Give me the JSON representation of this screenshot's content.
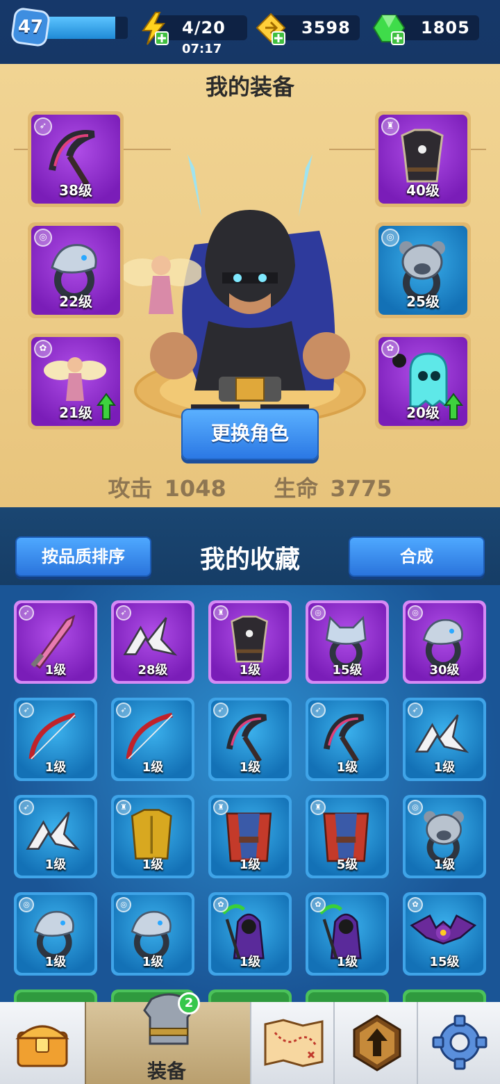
{
  "top_bar": {
    "player_level": "47",
    "xp_progress": 0.85,
    "energy": "4/20",
    "energy_timer": "07:17",
    "gold": "3598",
    "gems": "1805"
  },
  "equipment": {
    "title": "我的装备",
    "slots": [
      {
        "level": "38级",
        "type_icon": "weapon-icon",
        "art": "scythe",
        "color": "purple"
      },
      {
        "level": "22级",
        "type_icon": "ring-icon",
        "art": "dragon-ring",
        "color": "purple"
      },
      {
        "level": "21级",
        "type_icon": "pet-icon",
        "art": "fairy",
        "color": "purple",
        "upgrade": true
      },
      {
        "level": "40级",
        "type_icon": "armor-icon",
        "art": "dark-armor",
        "color": "purple"
      },
      {
        "level": "25级",
        "type_icon": "ring-icon",
        "art": "bear-ring",
        "color": "blue"
      },
      {
        "level": "20级",
        "type_icon": "pet-icon",
        "art": "ghost",
        "color": "purple",
        "upgrade": true
      }
    ],
    "change_button": "更换角色",
    "attack_label": "攻击",
    "attack_value": "1048",
    "hp_label": "生命",
    "hp_value": "3775"
  },
  "collection": {
    "sort_button": "按品质排序",
    "title": "我的收藏",
    "merge_button": "合成",
    "items": [
      {
        "level": "1级",
        "color": "purple",
        "type_icon": "weapon-icon",
        "art": "sword"
      },
      {
        "level": "28级",
        "color": "purple",
        "type_icon": "weapon-icon",
        "art": "shuriken"
      },
      {
        "level": "1级",
        "color": "purple",
        "type_icon": "armor-icon",
        "art": "dark-armor"
      },
      {
        "level": "15级",
        "color": "purple",
        "type_icon": "ring-icon",
        "art": "wolf-ring"
      },
      {
        "level": "30级",
        "color": "purple",
        "type_icon": "ring-icon",
        "art": "dragon-ring"
      },
      {
        "level": "1级",
        "color": "blue",
        "type_icon": "weapon-icon",
        "art": "bow"
      },
      {
        "level": "1级",
        "color": "blue",
        "type_icon": "weapon-icon",
        "art": "bow"
      },
      {
        "level": "1级",
        "color": "blue",
        "type_icon": "weapon-icon",
        "art": "scythe"
      },
      {
        "level": "1级",
        "color": "blue",
        "type_icon": "weapon-icon",
        "art": "scythe"
      },
      {
        "level": "1级",
        "color": "blue",
        "type_icon": "weapon-icon",
        "art": "shuriken"
      },
      {
        "level": "1级",
        "color": "blue",
        "type_icon": "weapon-icon",
        "art": "shuriken"
      },
      {
        "level": "1级",
        "color": "blue",
        "type_icon": "armor-icon",
        "art": "gold-armor"
      },
      {
        "level": "1级",
        "color": "blue",
        "type_icon": "armor-icon",
        "art": "red-robe"
      },
      {
        "level": "5级",
        "color": "blue",
        "type_icon": "armor-icon",
        "art": "red-robe"
      },
      {
        "level": "1级",
        "color": "blue",
        "type_icon": "ring-icon",
        "art": "bear-ring"
      },
      {
        "level": "1级",
        "color": "blue",
        "type_icon": "ring-icon",
        "art": "dragon-ring"
      },
      {
        "level": "1级",
        "color": "blue",
        "type_icon": "ring-icon",
        "art": "dragon-ring"
      },
      {
        "level": "1级",
        "color": "blue",
        "type_icon": "pet-icon",
        "art": "reaper"
      },
      {
        "level": "1级",
        "color": "blue",
        "type_icon": "pet-icon",
        "art": "reaper"
      },
      {
        "level": "15级",
        "color": "blue",
        "type_icon": "pet-icon",
        "art": "bat"
      }
    ]
  },
  "bottom_nav": {
    "active_label": "装备",
    "badge": "2",
    "tabs": [
      "chest-icon",
      "armor-icon",
      "map-icon",
      "upgrade-icon",
      "gear-icon"
    ]
  },
  "colors": {
    "purple": "#8a2fd0",
    "blue": "#1f7fc8",
    "green": "#3fb84f",
    "gold_panel": "#eccb86"
  }
}
